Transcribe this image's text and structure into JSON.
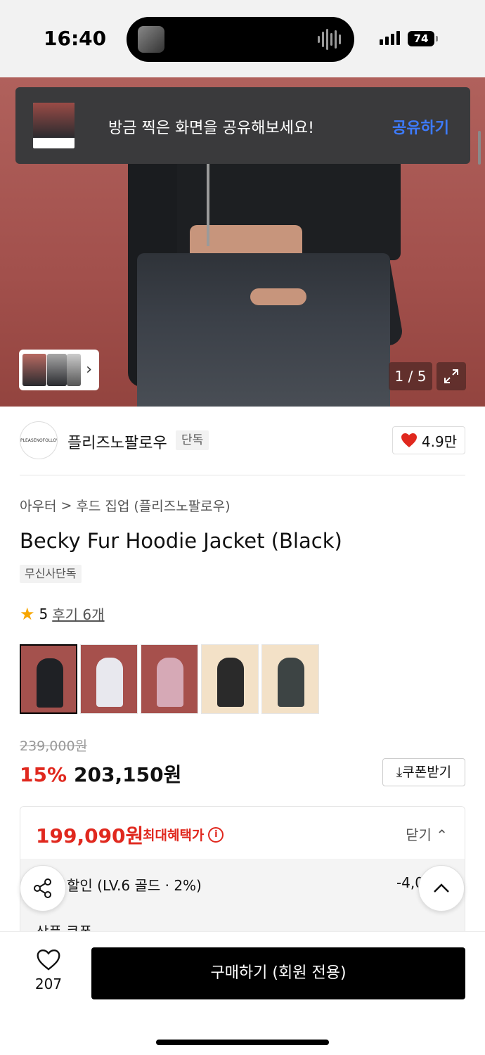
{
  "status_bar": {
    "time": "16:40",
    "battery": "74"
  },
  "toast": {
    "message": "방금 찍은 화면을 공유해보세요!",
    "action": "공유하기"
  },
  "hero": {
    "counter": "1 / 5"
  },
  "brand": {
    "logo_text": "PLEASENOFOLLOW",
    "name": "플리즈노팔로우",
    "badge": "단독",
    "likes": "4.9만"
  },
  "breadcrumb": {
    "category": "아우터",
    "separator": ">",
    "subcategory": "후드 집업 (플리즈노팔로우)"
  },
  "product": {
    "title": "Becky Fur Hoodie Jacket (Black)",
    "tag": "무신사단독",
    "rating": "5",
    "review_link": "후기 6개",
    "original_price": "239,000원",
    "discount": "15%",
    "sale_price": "203,150원",
    "coupon_button": "쿠폰받기"
  },
  "benefit": {
    "max_price": "199,090원",
    "label": "최대혜택가",
    "close": "닫기",
    "row1_label": "할인 (LV.6 골드 · 2%)",
    "row1_value": "-4,0",
    "row2_label": "상품 쿠폰"
  },
  "bottom": {
    "wish_count": "207",
    "buy_button": "구매하기 (회원 전용)"
  },
  "colors": {
    "accent": "#e0281e",
    "toast_link": "#3d7bff",
    "star": "#f7a600",
    "hero_bg": "#a2504c"
  },
  "icons": [
    "heart-icon",
    "star-icon",
    "share-icon",
    "chevron-up-icon",
    "expand-icon",
    "info-icon",
    "download-icon",
    "chevron-right-icon"
  ]
}
